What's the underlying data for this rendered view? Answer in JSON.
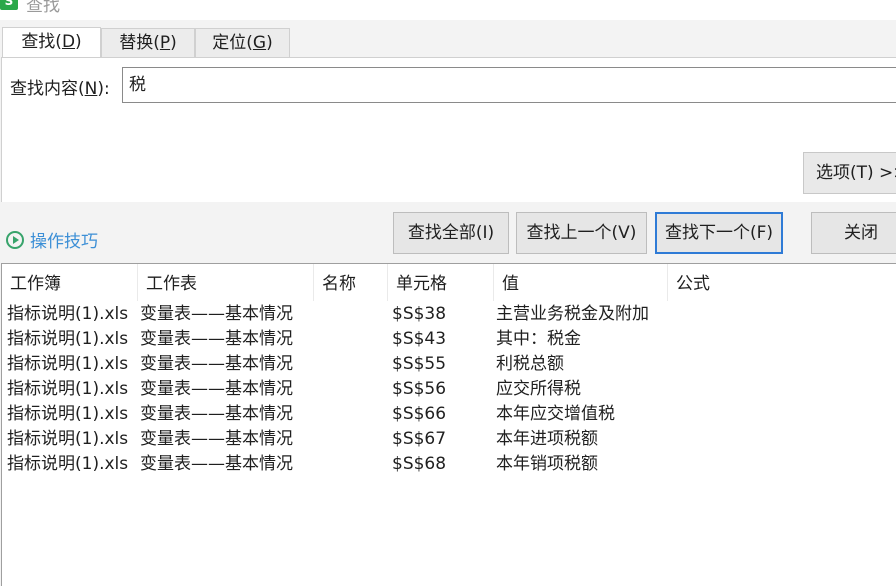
{
  "window": {
    "title": "查找",
    "app_icon": "S"
  },
  "tabs": [
    {
      "label": "查找(",
      "key": "D",
      "tail": ")",
      "active": true
    },
    {
      "label": "替换(",
      "key": "P",
      "tail": ")",
      "active": false
    },
    {
      "label": "定位(",
      "key": "G",
      "tail": ")",
      "active": false
    }
  ],
  "find": {
    "label_prefix": "查找内容(",
    "label_key": "N",
    "label_suffix": "):",
    "value": "税"
  },
  "options_button": {
    "label": "选项(T) >>"
  },
  "tips": {
    "label": "操作技巧",
    "icon": "play-circle-icon"
  },
  "buttons": {
    "find_all": "查找全部(I)",
    "find_prev": "查找上一个(V)",
    "find_next": "查找下一个(F)",
    "close": "关闭"
  },
  "results": {
    "columns": [
      "工作簿",
      "工作表",
      "名称",
      "单元格",
      "值",
      "公式"
    ],
    "rows": [
      {
        "workbook": "指标说明(1).xls",
        "sheet": "变量表——基本情况",
        "name": "",
        "cell": "$S$38",
        "value": "主营业务税金及附加",
        "formula": ""
      },
      {
        "workbook": "指标说明(1).xls",
        "sheet": "变量表——基本情况",
        "name": "",
        "cell": "$S$43",
        "value": "其中：税金",
        "formula": ""
      },
      {
        "workbook": "指标说明(1).xls",
        "sheet": "变量表——基本情况",
        "name": "",
        "cell": "$S$55",
        "value": "利税总额",
        "formula": ""
      },
      {
        "workbook": "指标说明(1).xls",
        "sheet": "变量表——基本情况",
        "name": "",
        "cell": "$S$56",
        "value": "应交所得税",
        "formula": ""
      },
      {
        "workbook": "指标说明(1).xls",
        "sheet": "变量表——基本情况",
        "name": "",
        "cell": "$S$66",
        "value": "本年应交增值税",
        "formula": ""
      },
      {
        "workbook": "指标说明(1).xls",
        "sheet": "变量表——基本情况",
        "name": "",
        "cell": "$S$67",
        "value": "本年进项税额",
        "formula": ""
      },
      {
        "workbook": "指标说明(1).xls",
        "sheet": "变量表——基本情况",
        "name": "",
        "cell": "$S$68",
        "value": "本年销项税额",
        "formula": ""
      }
    ]
  },
  "colors": {
    "accent": "#2f7bd6",
    "tips_text": "#3c8fd6",
    "tips_icon": "#37a36b",
    "app_icon": "#2aa84a"
  }
}
